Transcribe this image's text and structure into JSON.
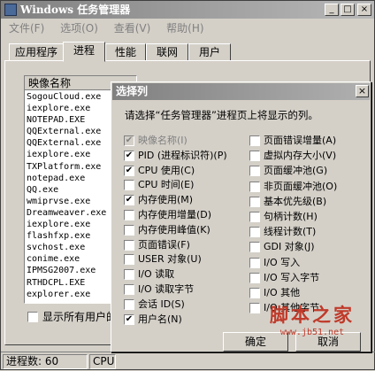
{
  "window": {
    "title": "Windows 任务管理器",
    "controls": {
      "minimize": "_",
      "maximize": "□",
      "close": "×"
    }
  },
  "menu": [
    "文件(F)",
    "选项(O)",
    "查看(V)",
    "帮助(H)"
  ],
  "tabs": [
    {
      "label": "应用程序",
      "active": false
    },
    {
      "label": "进程",
      "active": true
    },
    {
      "label": "性能",
      "active": false
    },
    {
      "label": "联网",
      "active": false
    },
    {
      "label": "用户",
      "active": false
    }
  ],
  "process_list": {
    "header": "映像名称",
    "rows": [
      "SogouCloud.exe",
      "iexplore.exe",
      "NOTEPAD.EXE",
      "QQExternal.exe",
      "QQExternal.exe",
      "iexplore.exe",
      "TXPlatform.exe",
      "notepad.exe",
      "QQ.exe",
      "wmiprvse.exe",
      "Dreamweaver.exe",
      "iexplore.exe",
      "flashfxp.exe",
      "svchost.exe",
      "conime.exe",
      "IPMSG2007.exe",
      "RTHDCPL.EXE",
      "explorer.exe"
    ]
  },
  "show_all_users": {
    "label": "显示所有用户的",
    "checked": false
  },
  "status": {
    "process_count": "进程数: 60",
    "cpu": "CPU"
  },
  "dialog": {
    "title": "选择列",
    "close": "×",
    "instruction": "请选择“任务管理器”进程页上将显示的列。",
    "left_options": [
      {
        "label": "映像名称(I)",
        "checked": true,
        "disabled": true
      },
      {
        "label": "PID (进程标识符)(P)",
        "checked": true,
        "disabled": false
      },
      {
        "label": "CPU 使用(C)",
        "checked": true,
        "disabled": false
      },
      {
        "label": "CPU 时间(E)",
        "checked": false,
        "disabled": false
      },
      {
        "label": "内存使用(M)",
        "checked": true,
        "disabled": false
      },
      {
        "label": "内存使用增量(D)",
        "checked": false,
        "disabled": false
      },
      {
        "label": "内存使用峰值(K)",
        "checked": false,
        "disabled": false
      },
      {
        "label": "页面错误(F)",
        "checked": false,
        "disabled": false
      },
      {
        "label": "USER 对象(U)",
        "checked": false,
        "disabled": false
      },
      {
        "label": "I/O 读取",
        "checked": false,
        "disabled": false
      },
      {
        "label": "I/O 读取字节",
        "checked": false,
        "disabled": false
      },
      {
        "label": "会话 ID(S)",
        "checked": false,
        "disabled": false
      },
      {
        "label": "用户名(N)",
        "checked": true,
        "disabled": false
      }
    ],
    "right_options": [
      {
        "label": "页面错误增量(A)",
        "checked": false
      },
      {
        "label": "虚拟内存大小(V)",
        "checked": false
      },
      {
        "label": "页面缓冲池(G)",
        "checked": false
      },
      {
        "label": "非页面缓冲池(O)",
        "checked": false
      },
      {
        "label": "基本优先级(B)",
        "checked": false
      },
      {
        "label": "句柄计数(H)",
        "checked": false
      },
      {
        "label": "线程计数(T)",
        "checked": false
      },
      {
        "label": "GDI 对象(J)",
        "checked": false
      },
      {
        "label": "I/O 写入",
        "checked": false
      },
      {
        "label": "I/O 写入字节",
        "checked": false
      },
      {
        "label": "I/O 其他",
        "checked": false
      },
      {
        "label": "I/O 其他字节",
        "checked": false
      }
    ],
    "ok_label": "确定",
    "cancel_label": "取消"
  },
  "watermark": {
    "text": "脚本之家",
    "url": "www.jb51.net"
  },
  "check_mark": "✔"
}
